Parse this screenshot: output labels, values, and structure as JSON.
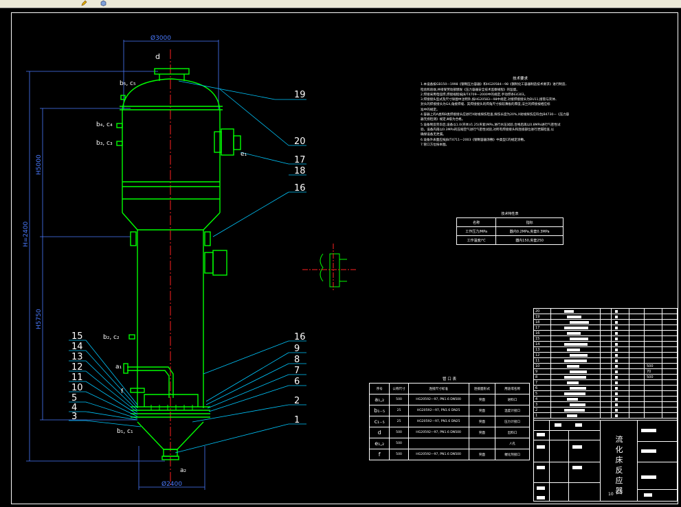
{
  "toolbar": {
    "icons": [
      "pencil-icon",
      "cube-icon"
    ]
  },
  "drawing": {
    "nozzle_top": "d",
    "dims": {
      "top_width": "Ø3000",
      "bottom_width": "Ø2400",
      "height_total": "H=2400",
      "height_upper": "H5000",
      "height_lower": "H5750"
    },
    "nozzle_labels": [
      "b₅, c₅",
      "b₄, c₄",
      "b₃, c₃",
      "e₁",
      "b₂, c₂",
      "a₁",
      "f",
      "b₁, c₁",
      "a₂"
    ],
    "part_numbers_right": [
      "19",
      "20",
      "17",
      "18",
      "16",
      "16",
      "9",
      "8",
      "7",
      "6",
      "2",
      "1"
    ],
    "part_numbers_left": [
      "15",
      "14",
      "13",
      "12",
      "11",
      "10",
      "5",
      "4",
      "3"
    ]
  },
  "tech_req": {
    "title": "技术要求",
    "lines": [
      "1.本设备按GB150—1998《钢制压力容器》和HG20584—98《钢制化工容器制造技术要求》进行制造、",
      "检验和验收,并接受劳动部颁发《压力容器安全技术监察规程》的监督。",
      "2.焊接采用电弧焊,焊接规程按JB/T4709—2000中的规定,手动焊条E4303。",
      "3.焊接接头型式及尺寸除图中注明外,按HG20583—98中规定,对接焊接接头为DU11,接管与壳体、",
      "封头的焊接接头为G4,角接焊缝、其焊接接头的焊角尺寸按较薄板的厚度,法兰的焊接按相应标",
      "准中的规定。",
      "4.容器上的A类和B类焊接接头应进行X射线探伤检查,探伤长度为20%,X射线探伤应符合JB4730—《压力容",
      "器无损检测》规定,Ⅲ级为合格。",
      "5.设备制造完毕后,设备以1.0(壳体)/1.25(夹套)MPa,进行水压试验,合格后再以0.8MPa进行气密性试",
      "验。设备内再以0.3MPa的压缩空气进行气密性试验,对所有焊接接头和连接部位进行泄漏检查,以",
      "确保设备无泄漏。",
      "6.设备外表面应按JB/T4711—2003《钢制容器涂敷》中类型C的规定涂敷。",
      "7.管口方位按本图。"
    ]
  },
  "tech_char": {
    "title": "技术特性表",
    "headers": [
      "名称",
      "指标"
    ],
    "rows": [
      [
        "工作压力/MPa",
        "器内0.2MPa,夹套0.3MPa"
      ],
      [
        "工作温度/℃",
        "器内150,夹套250"
      ]
    ]
  },
  "nozzle_table": {
    "title": "管 口 表",
    "headers": [
      "序号",
      "公称尺寸",
      "连接尺寸标准",
      "连接面形式",
      "用途或名称"
    ],
    "rows": [
      [
        "a₁,₂",
        "500",
        "HG20592—97, PN1.6 DN500",
        "突面",
        "进料口"
      ],
      [
        "b₁₋₅",
        "25",
        "HG20592—97, PN1.6 DN25",
        "突面",
        "温度计接口"
      ],
      [
        "c₁₋₅",
        "25",
        "HG20592—97, PN1.6 DN25",
        "突面",
        "压力计接口"
      ],
      [
        "d",
        "500",
        "HG20592—97, PN1.6 DN500",
        "突面",
        "出料口"
      ],
      [
        "e₁,₂",
        "500",
        "",
        "",
        "人孔"
      ],
      [
        "f",
        "500",
        "HG20592—97, PN1.6 DN500",
        "突面",
        "催化剂接口"
      ]
    ]
  },
  "title_block": {
    "name_chars": [
      "流",
      "化",
      "床",
      "反",
      "应",
      "器"
    ],
    "parts_rows": [
      "20",
      "19",
      "18",
      "17",
      "16",
      "15",
      "14",
      "13",
      "12",
      "11",
      "10",
      "9",
      "8",
      "7",
      "6",
      "5",
      "4",
      "3",
      "2",
      "1"
    ],
    "weights": [
      "500",
      "70",
      "500"
    ],
    "sheet": "10"
  },
  "colors": {
    "line": "#00ff00",
    "dim": "#4a7bff",
    "leader": "#00c8ff",
    "center": "#ff2020",
    "text": "#ffffff",
    "yellow": "#ffff00"
  }
}
